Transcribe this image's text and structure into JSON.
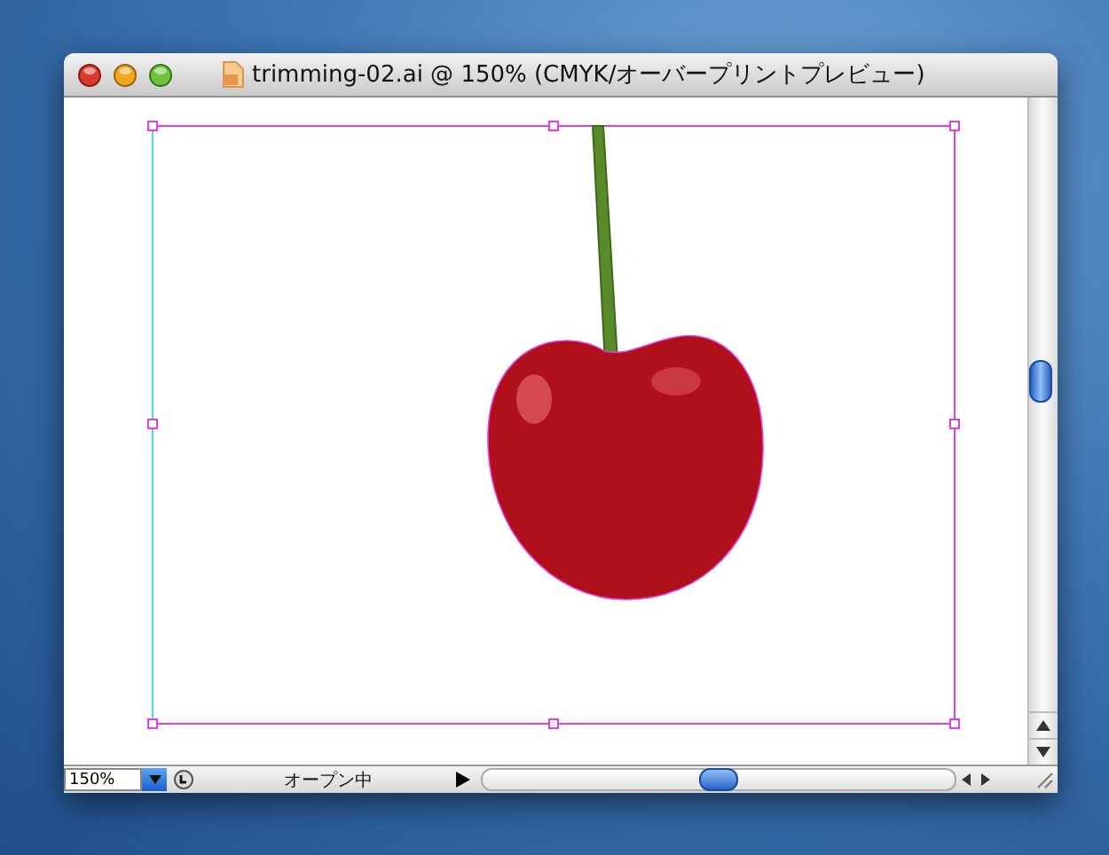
{
  "window": {
    "title": "trimming-02.ai @ 150% (CMYK/オーバープリントプレビュー)"
  },
  "status_bar": {
    "zoom": "150%",
    "status": "オープン中"
  }
}
